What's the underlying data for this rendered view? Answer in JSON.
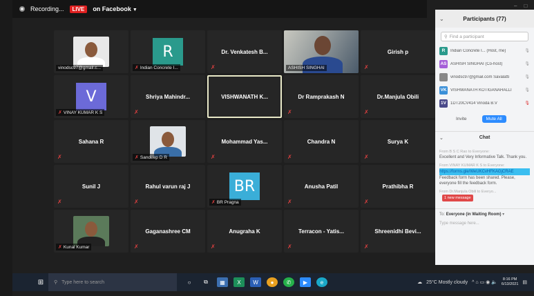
{
  "topbar": {
    "recording_label": "Recording...",
    "live_label": "LIVE",
    "facebook_label": "on Facebook"
  },
  "tiles": [
    {
      "name": "",
      "label": "vinodsc97@gmail.c...",
      "type": "photo",
      "photo_bg": "#e8e8e8",
      "body": "#ffffff",
      "muted": false
    },
    {
      "name": "",
      "label": "Indian Concrete I...",
      "type": "letter",
      "letter": "R",
      "color": "#2a9a8c",
      "muted": true
    },
    {
      "name": "Dr. Venkatesh B...",
      "label": "",
      "type": "name",
      "muted": true
    },
    {
      "name": "",
      "label": "ASHISH SINGHAI",
      "type": "video",
      "muted": false
    },
    {
      "name": "Girish p",
      "label": "",
      "type": "name",
      "muted": true
    },
    {
      "name": "",
      "label": "VINAY KUMAR K S",
      "type": "letter",
      "letter": "V",
      "color": "#6c6ad8",
      "muted": true
    },
    {
      "name": "Shriya Mahindr...",
      "label": "",
      "type": "name",
      "muted": true
    },
    {
      "name": "VISHWANATH K...",
      "label": "",
      "type": "name",
      "muted": false,
      "active": true
    },
    {
      "name": "Dr Ramprakash N",
      "label": "",
      "type": "name",
      "muted": true
    },
    {
      "name": "Dr.Manjula Obili",
      "label": "",
      "type": "name",
      "muted": true
    },
    {
      "name": "Sahana R",
      "label": "",
      "type": "name",
      "muted": true
    },
    {
      "name": "",
      "label": "Sandeep D R",
      "type": "photo",
      "photo_bg": "#e0e4e8",
      "body": "#3a6fa8",
      "muted": true
    },
    {
      "name": "Mohammad Yas...",
      "label": "",
      "type": "name",
      "muted": true
    },
    {
      "name": "Chandra N",
      "label": "",
      "type": "name",
      "muted": true
    },
    {
      "name": "Surya K",
      "label": "",
      "type": "name",
      "muted": true
    },
    {
      "name": "Sunil J",
      "label": "",
      "type": "name",
      "muted": true
    },
    {
      "name": "Rahul varun raj J",
      "label": "",
      "type": "name",
      "muted": true
    },
    {
      "name": "",
      "label": "BR Pragna",
      "type": "letter",
      "letter": "BR",
      "color": "#3aaed8",
      "muted": true
    },
    {
      "name": "Anusha Patil",
      "label": "",
      "type": "name",
      "muted": true
    },
    {
      "name": "Prathibha R",
      "label": "",
      "type": "name",
      "muted": true
    },
    {
      "name": "",
      "label": "Kunal Kumar",
      "type": "photo",
      "photo_bg": "#5b7a5a",
      "body": "#222222",
      "muted": true
    },
    {
      "name": "Gaganashree CM",
      "label": "",
      "type": "name",
      "muted": true
    },
    {
      "name": "Anugraha K",
      "label": "",
      "type": "name",
      "muted": true
    },
    {
      "name": "Terracon - Yatis...",
      "label": "",
      "type": "name",
      "muted": true
    },
    {
      "name": "Shreenidhi Bevi...",
      "label": "",
      "type": "name",
      "muted": true
    }
  ],
  "panel": {
    "title": "Participants (77)",
    "search_placeholder": "Find a participant",
    "participants": [
      {
        "initials": "R",
        "color": "#2a9a8c",
        "name": "Indian Concrete I... (Host, me)"
      },
      {
        "initials": "AS",
        "color": "#a560d8",
        "name": "ASHISH SINGHAI (Co-host)"
      },
      {
        "initials": "",
        "color": "#888888",
        "name": "vinodsc97@gmail.com Savalatti"
      },
      {
        "initials": "VK",
        "color": "#3a8fd8",
        "name": "VISHWANATH KOTIGANAHALLI"
      },
      {
        "initials": "1V",
        "color": "#4a4a8a",
        "name": "1DT20CV414 Vinoda B.V"
      }
    ],
    "invite_label": "Invite",
    "mute_all_label": "Mute All",
    "chat_title": "Chat",
    "chat": [
      {
        "from": "From B S C Rao to Everyone:",
        "msg": "Excellent and Very Informative Talk. Thank you."
      },
      {
        "from": "From VINAY KUMAR K S to Everyone:",
        "msg": "https://forms.gle/WeUKCvHFKAGjCRAE",
        "link": true
      },
      {
        "from": "",
        "msg": "Feedback form has been shared. Please, everyone fill the feedback form."
      },
      {
        "from": "From Dr.Manjula Obili to Everyo...",
        "msg": ""
      }
    ],
    "new_message_label": "1 new message",
    "to_label": "To:",
    "to_value": "Everyone (in Waiting Room)",
    "type_placeholder": "Type message here..."
  },
  "taskbar": {
    "search_placeholder": "Type here to search",
    "weather": "25°C  Mostly cloudy",
    "time": "8:16 PM",
    "date": "6/13/2021"
  }
}
